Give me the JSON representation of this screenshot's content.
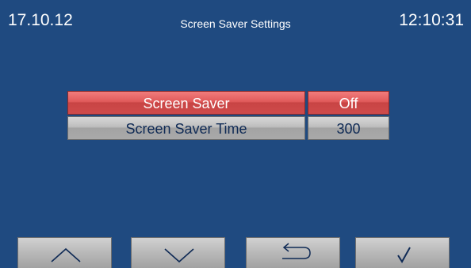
{
  "header": {
    "date": "17.10.12",
    "title": "Screen Saver Settings",
    "time": "12:10:31"
  },
  "settings": [
    {
      "label": "Screen Saver",
      "value": "Off"
    },
    {
      "label": "Screen Saver Time",
      "value": "300"
    }
  ],
  "nav": {
    "up_icon": "chevron-up-icon",
    "down_icon": "chevron-down-icon",
    "back_icon": "return-arrow-icon",
    "ok_icon": "checkmark-icon"
  },
  "colors": {
    "background": "#1f4a80",
    "selected_row": "#e05a5a",
    "row": "#b8b8b8",
    "text_dark": "#0f2a55"
  }
}
